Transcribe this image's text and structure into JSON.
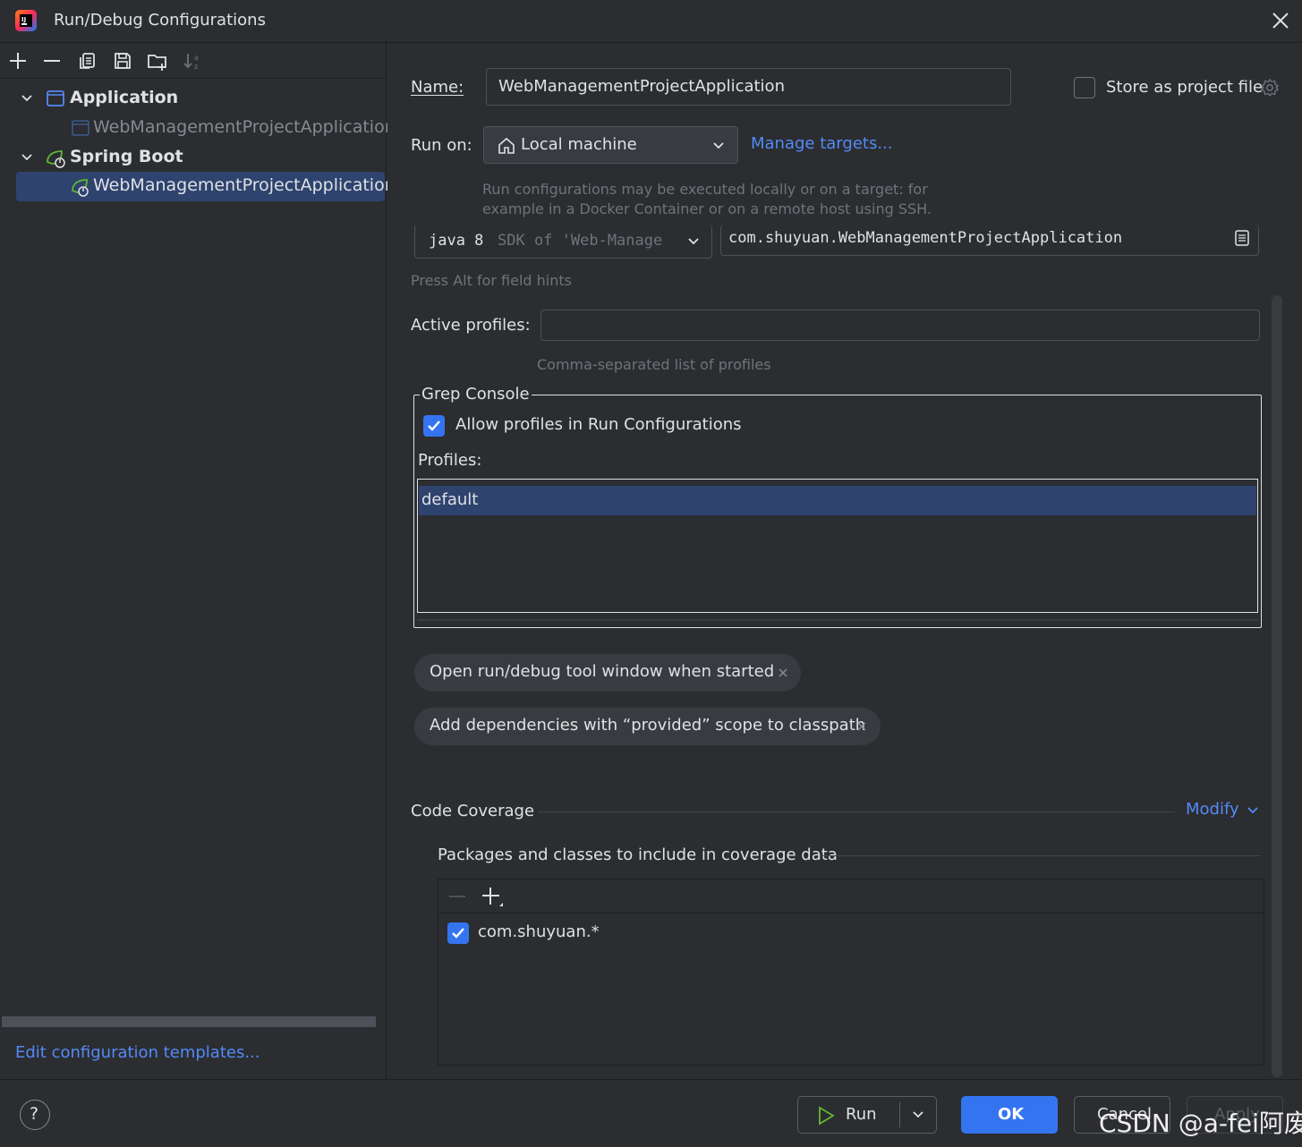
{
  "window": {
    "title": "Run/Debug Configurations"
  },
  "tree": {
    "groups": [
      {
        "label": "Application",
        "children": [
          "WebManagementProjectApplication"
        ]
      },
      {
        "label": "Spring Boot",
        "children": [
          "WebManagementProjectApplication"
        ]
      }
    ],
    "selected": "WebManagementProjectApplication"
  },
  "left_footer": {
    "edit_templates": "Edit configuration templates..."
  },
  "form": {
    "name_label": "Name:",
    "name_value": "WebManagementProjectApplication",
    "store_label": "Store as project file",
    "store_checked": false,
    "run_on_label": "Run on:",
    "run_on_value": "Local machine",
    "manage_targets": "Manage targets...",
    "run_on_hint_1": "Run configurations may be executed locally or on a target: for",
    "run_on_hint_2": "example in a Docker Container or on a remote host using SSH.",
    "jdk_value": "java 8",
    "jdk_suffix": "SDK of 'Web-Manage",
    "main_class": "com.shuyuan.WebManagementProjectApplication",
    "alt_hint": "Press Alt for field hints",
    "active_profiles_label": "Active profiles:",
    "active_profiles_value": "",
    "active_profiles_hint": "Comma-separated list of profiles"
  },
  "grep_console": {
    "title": "Grep Console",
    "allow_label": "Allow profiles in Run Configurations",
    "allow_checked": true,
    "profiles_label": "Profiles:",
    "profiles": [
      "default"
    ]
  },
  "chips": [
    "Open run/debug tool window when started",
    "Add dependencies with “provided” scope to classpath"
  ],
  "coverage": {
    "title": "Code Coverage",
    "modify": "Modify",
    "packages_label": "Packages and classes to include in coverage data",
    "items": [
      {
        "label": "com.shuyuan.*",
        "checked": true
      }
    ]
  },
  "buttons": {
    "run": "Run",
    "ok": "OK",
    "cancel": "Cancel",
    "apply": "Apply",
    "help": "?"
  },
  "watermark": "CSDN @a-fei阿废",
  "colors": {
    "accent": "#3574f0",
    "link": "#548af7",
    "selection": "#2e436e",
    "background": "#2b2d30"
  }
}
